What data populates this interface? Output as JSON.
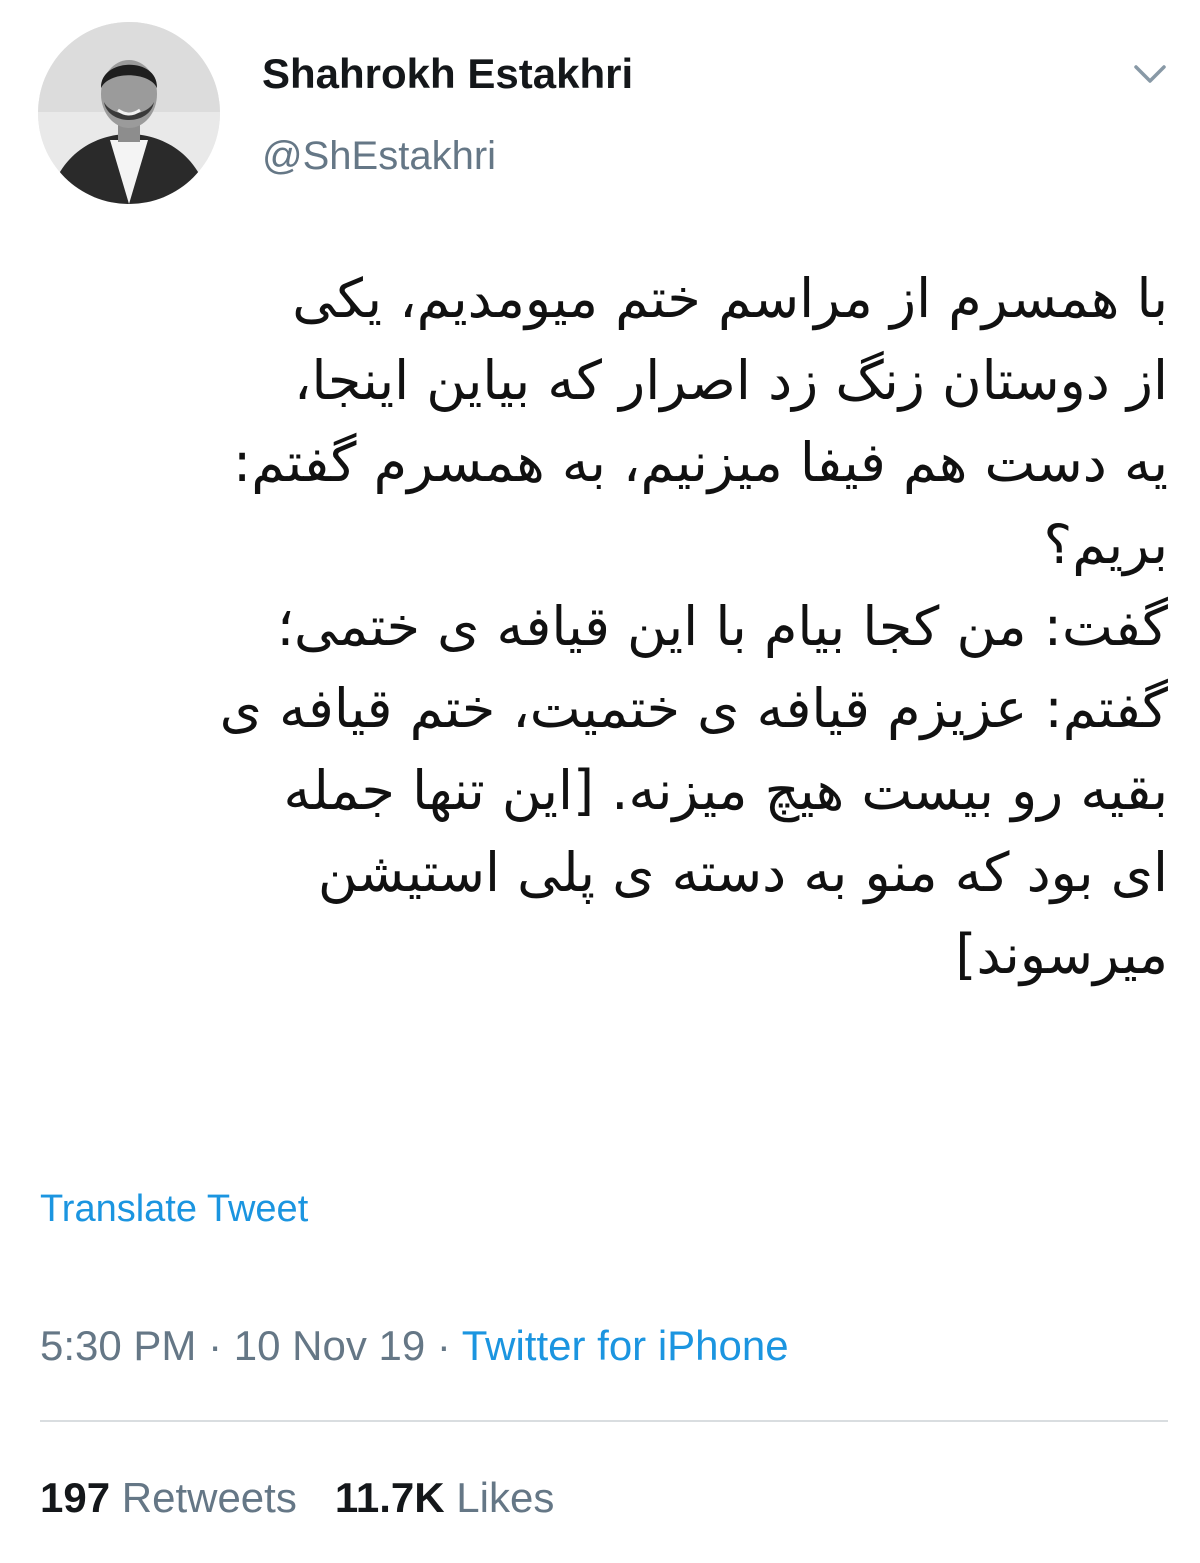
{
  "author": {
    "display_name": "Shahrokh Estakhri",
    "handle": "@ShEstakhri"
  },
  "tweet": {
    "lines": [
      "با همسرم از مراسم ختم میومدیم، یکی",
      "از دوستان زنگ زد اصرار که بیاین اینجا،",
      "یه دست هم فیفا میزنیم، به همسرم گفتم:",
      "بریم؟",
      "گفت: من کجا بیام با این قیافه ی ختمی؛",
      "گفتم: عزیزم قیافه ی ختمیت، ختم قیافه ی",
      "بقیه رو بیست هیچ میزنه. [این تنها جمله",
      "ای بود که منو به دسته ی پلی استیشن",
      "میرسوند]"
    ],
    "translate_label": "Translate Tweet"
  },
  "meta": {
    "time": "5:30 PM",
    "separator": " · ",
    "date": "10 Nov 19",
    "source": "Twitter for iPhone"
  },
  "stats": {
    "retweets_count": "197",
    "retweets_label": "Retweets",
    "likes_count": "11.7K",
    "likes_label": "Likes"
  },
  "icons": {
    "caret": "chevron-down-icon"
  },
  "colors": {
    "link": "#1b95e0",
    "secondary_text": "#657786",
    "primary_text": "#14171a",
    "divider": "#d9dde0"
  }
}
